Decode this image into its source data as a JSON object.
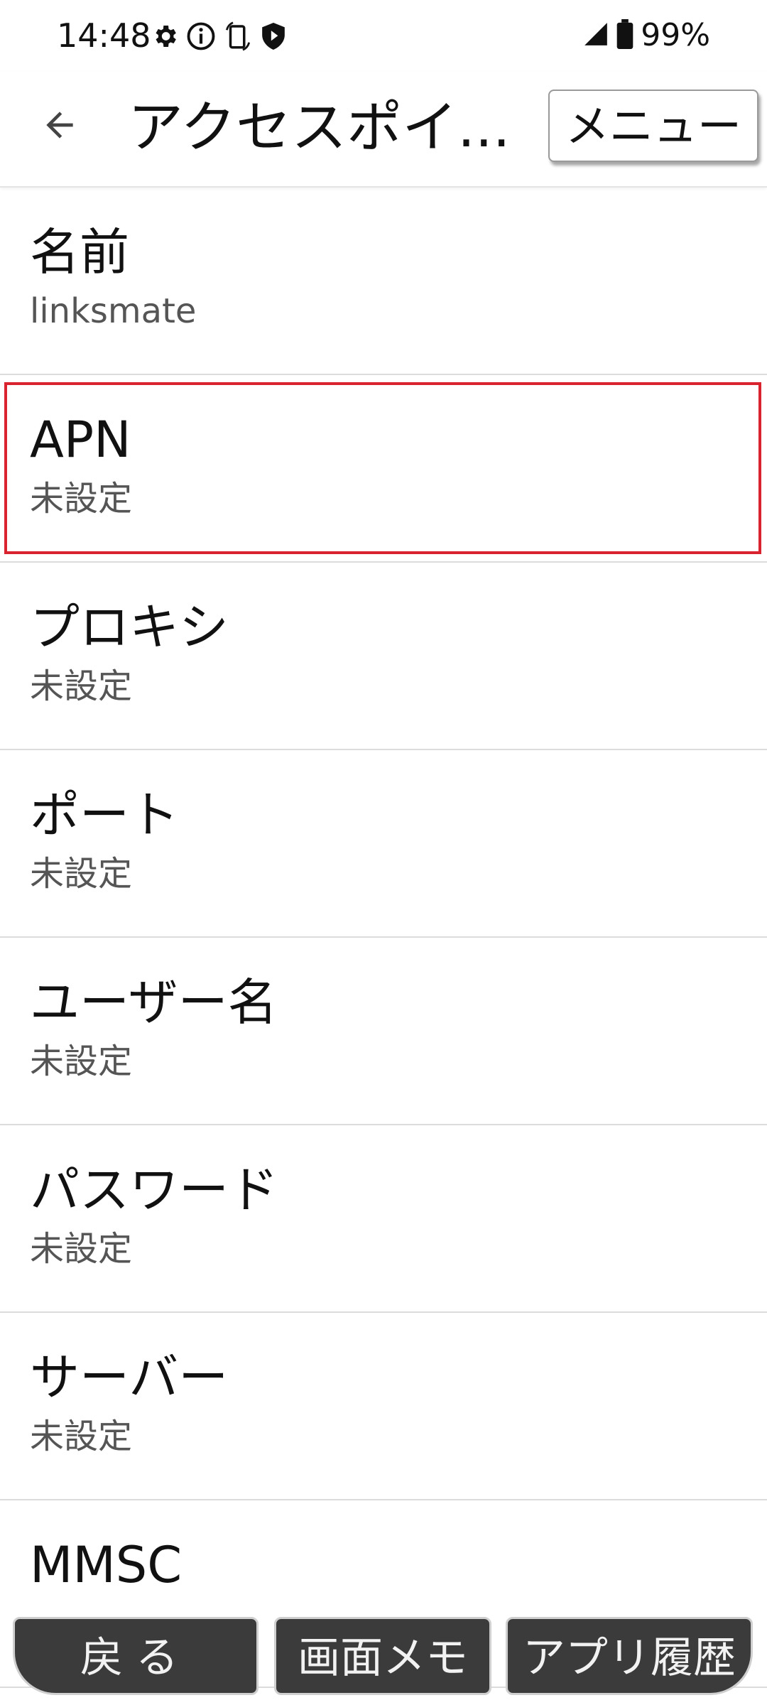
{
  "status_bar": {
    "time": "14:48",
    "battery_text": "99%",
    "icons": [
      "gear-icon",
      "info-icon",
      "screen-rotate-icon",
      "shield-icon",
      "signal-icon",
      "battery-icon"
    ]
  },
  "app_bar": {
    "title": "アクセスポイ...",
    "menu_label": "メニュー",
    "back_icon": "back-arrow-icon"
  },
  "preferences": [
    {
      "title": "名前",
      "summary": "linksmate"
    },
    {
      "title": "APN",
      "summary": "未設定"
    },
    {
      "title": "プロキシ",
      "summary": "未設定"
    },
    {
      "title": "ポート",
      "summary": "未設定"
    },
    {
      "title": "ユーザー名",
      "summary": "未設定"
    },
    {
      "title": "パスワード",
      "summary": "未設定"
    },
    {
      "title": "サーバー",
      "summary": "未設定"
    },
    {
      "title": "MMSC",
      "summary": ""
    }
  ],
  "highlight": {
    "target": "APN",
    "color": "#d9232e"
  },
  "bottom_nav": {
    "back_label": "戻る",
    "memo_label": "画面メモ",
    "history_label": "アプリ履歴"
  },
  "colors": {
    "background": "#ffffff",
    "nav_button": "#3b3b3b",
    "highlight": "#d9232e"
  }
}
